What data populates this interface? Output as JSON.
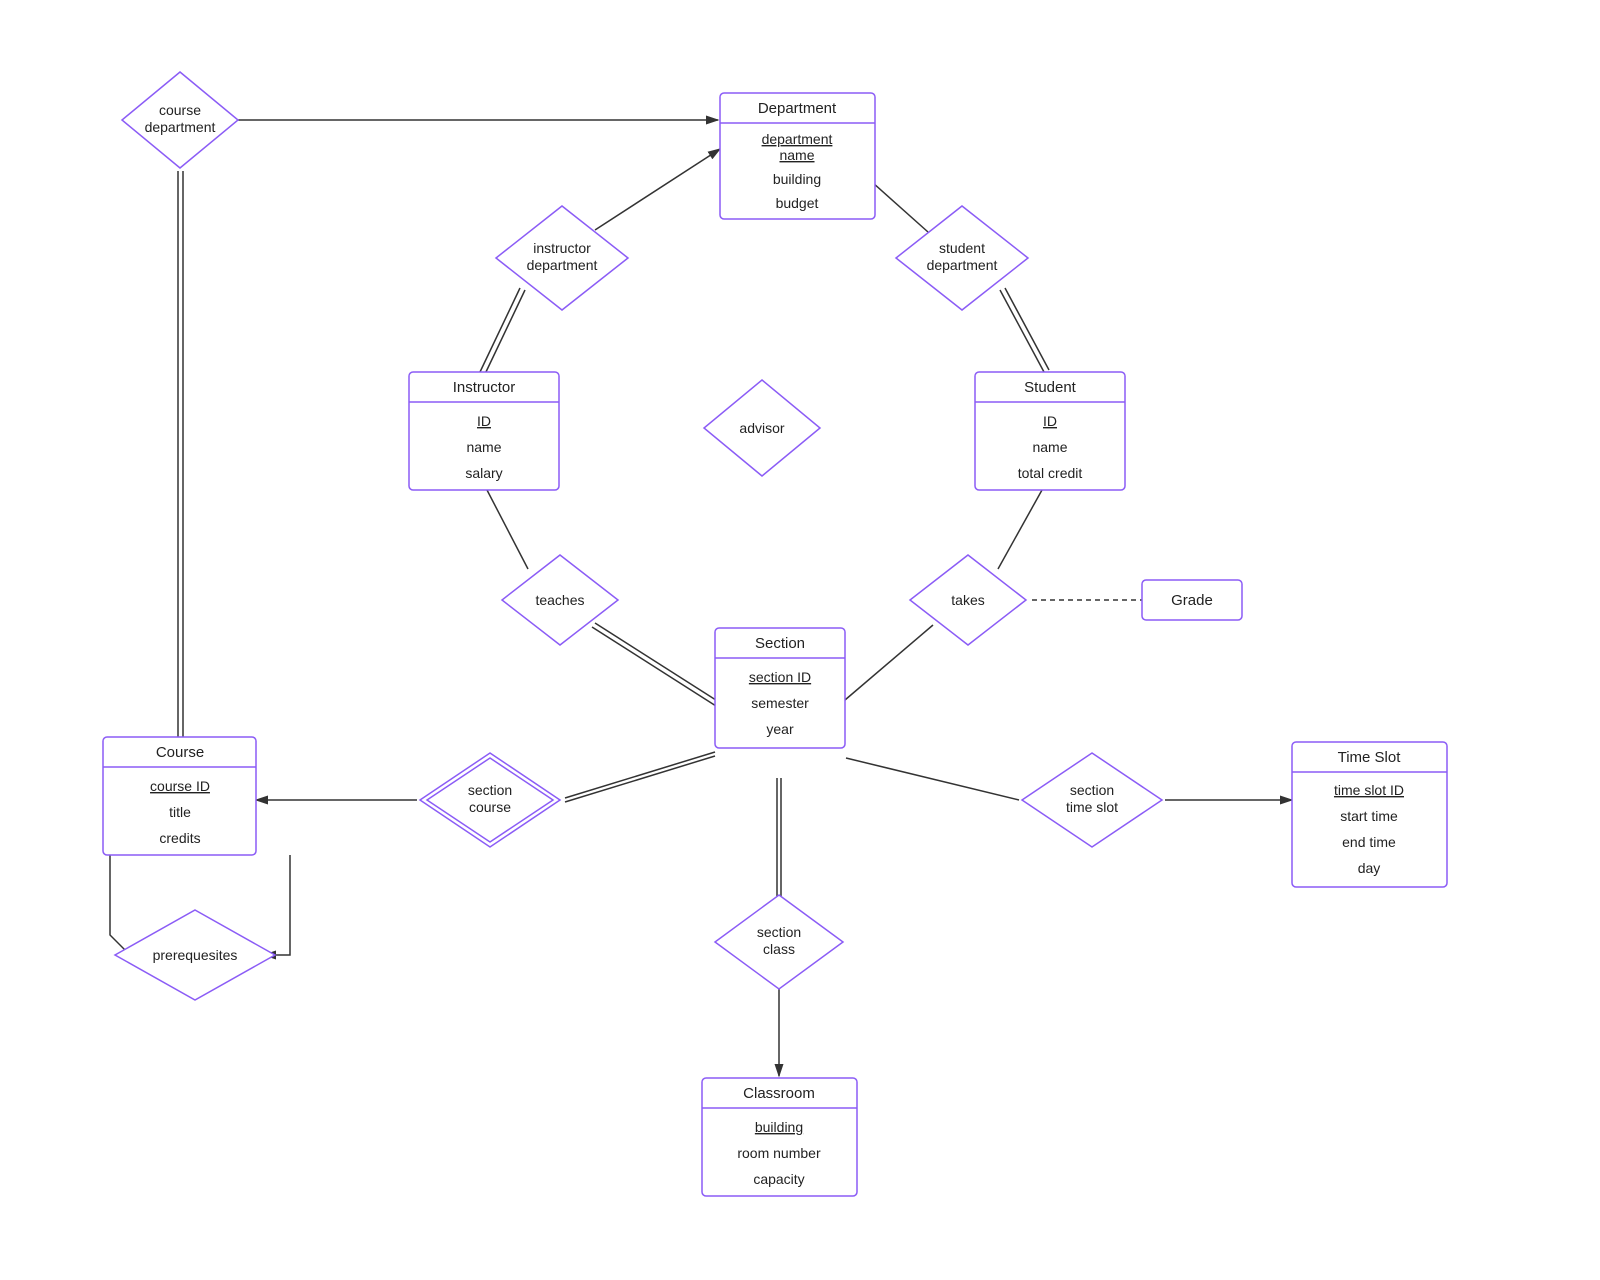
{
  "entities": {
    "department": {
      "title": "Department",
      "attrs": [
        "department name",
        "building",
        "budget"
      ],
      "key": 0
    },
    "instructor": {
      "title": "Instructor",
      "attrs": [
        "ID",
        "name",
        "salary"
      ],
      "key": 0
    },
    "student": {
      "title": "Student",
      "attrs": [
        "ID",
        "name",
        "total credit"
      ],
      "key": 0
    },
    "section": {
      "title": "Section",
      "attrs": [
        "section ID",
        "semester",
        "year"
      ],
      "key": 0
    },
    "course": {
      "title": "Course",
      "attrs": [
        "course ID",
        "title",
        "credits"
      ],
      "key": 0
    },
    "timeslot": {
      "title": "Time Slot",
      "attrs": [
        "time slot ID",
        "start time",
        "end time",
        "day"
      ],
      "key": 0
    },
    "classroom": {
      "title": "Classroom",
      "attrs": [
        "building",
        "room number",
        "capacity"
      ],
      "key": 0
    },
    "grade": {
      "title": "Grade",
      "attrs": []
    }
  },
  "relationships": {
    "course_department": "course department",
    "instructor_department": "instructor department",
    "student_department": "student department",
    "advisor": "advisor",
    "teaches": "teaches",
    "takes": "takes",
    "section_course": "section course",
    "section_timeslot": "section time slot",
    "section_class": "section class",
    "prerequisites": "prerequesites"
  }
}
